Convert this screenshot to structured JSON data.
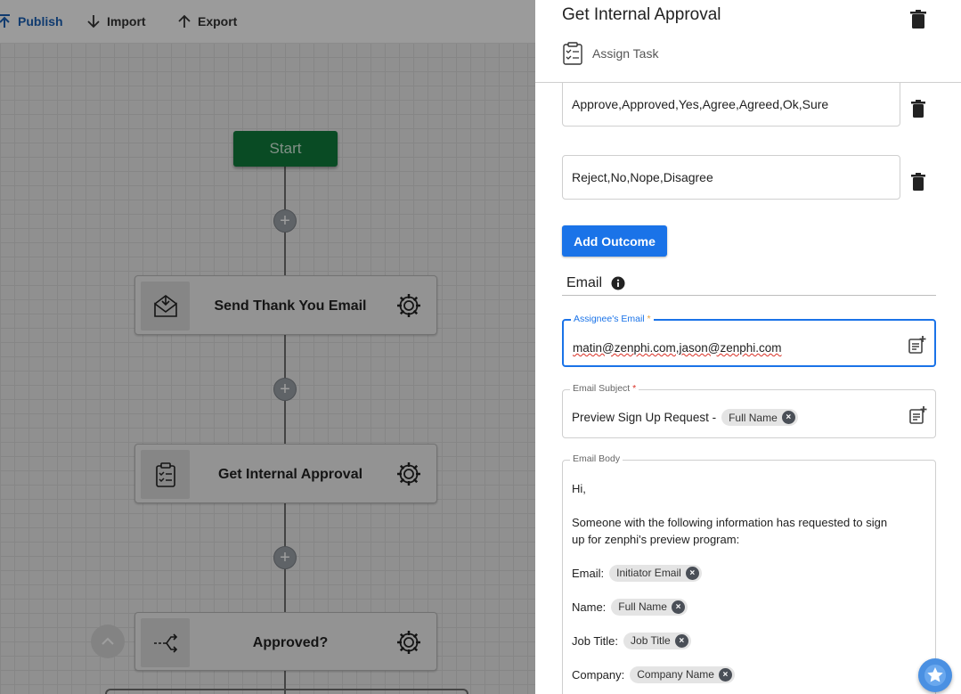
{
  "toolbar": {
    "publish_label": "Publish",
    "import_label": "Import",
    "export_label": "Export"
  },
  "canvas": {
    "start_label": "Start",
    "nodes": [
      {
        "title": "Send Thank You Email",
        "icon": "envelope-icon"
      },
      {
        "title": "Get Internal Approval",
        "icon": "clipboard-icon"
      },
      {
        "title": "Approved?",
        "icon": "branch-icon"
      }
    ]
  },
  "panel": {
    "title": "Get Internal Approval",
    "task_label": "Assign Task",
    "outcomes": [
      "Approve,Approved,Yes,Agree,Agreed,Ok,Sure",
      "Reject,No,Nope,Disagree"
    ],
    "add_outcome_label": "Add Outcome",
    "email_section_title": "Email",
    "assignee_email": {
      "label": "Assignee's Email",
      "required_mark": "*",
      "value": "matin@zenphi.com,jason@zenphi.com"
    },
    "email_subject": {
      "label": "Email Subject",
      "required_mark": "*",
      "text": "Preview Sign Up Request -",
      "chip": "Full Name"
    },
    "email_body": {
      "label": "Email Body",
      "greeting": "Hi,",
      "paragraph": "Someone with the following information has requested to sign up for zenphi's preview program:",
      "lines": [
        {
          "label": "Email:",
          "chip": "Initiator Email"
        },
        {
          "label": "Name:",
          "chip": "Full Name"
        },
        {
          "label": "Job Title:",
          "chip": "Job Title"
        },
        {
          "label": "Company:",
          "chip": "Company Name"
        }
      ]
    }
  },
  "colors": {
    "accent": "#1a73e8",
    "start_node": "#0f7a3a",
    "fab": "#4a90e2"
  }
}
